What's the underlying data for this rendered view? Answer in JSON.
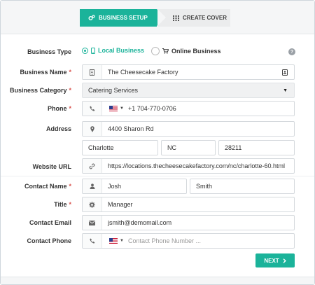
{
  "steps": {
    "active_label": "BUSINESS SETUP",
    "inactive_label": "CREATE COVER"
  },
  "business_type": {
    "label": "Business Type",
    "option_local": "Local Business",
    "option_online": "Online Business",
    "selected": "Local Business"
  },
  "business_name": {
    "label": "Business Name",
    "required": "*",
    "value": "The Cheesecake Factory"
  },
  "business_category": {
    "label": "Business Category",
    "required": "*",
    "value": "Catering Services"
  },
  "phone": {
    "label": "Phone",
    "required": "*",
    "value": "+1 704-770-0706"
  },
  "address": {
    "label": "Address",
    "street": "4400 Sharon Rd",
    "city": "Charlotte",
    "state": "NC",
    "zip": "28211"
  },
  "website": {
    "label": "Website URL",
    "value": "https://locations.thecheesecakefactory.com/nc/charlotte-60.html"
  },
  "contact_name": {
    "label": "Contact Name",
    "required": "*",
    "first": "Josh",
    "last": "Smith"
  },
  "title": {
    "label": "Title",
    "required": "*",
    "value": "Manager"
  },
  "contact_email": {
    "label": "Contact Email",
    "value": "jsmith@demomail.com"
  },
  "contact_phone": {
    "label": "Contact Phone",
    "placeholder": "Contact Phone Number ..."
  },
  "next_button": {
    "label": "NEXT"
  },
  "colors": {
    "accent": "#1bb39a",
    "required": "#d9534f"
  },
  "icons": [
    "cogs-icon",
    "grid-icon",
    "mobile-icon",
    "cart-icon",
    "help-icon",
    "building-icon",
    "id-card-icon",
    "phone-icon",
    "map-marker-icon",
    "link-icon",
    "user-icon",
    "gear-icon",
    "envelope-icon",
    "chevron-right-icon"
  ]
}
